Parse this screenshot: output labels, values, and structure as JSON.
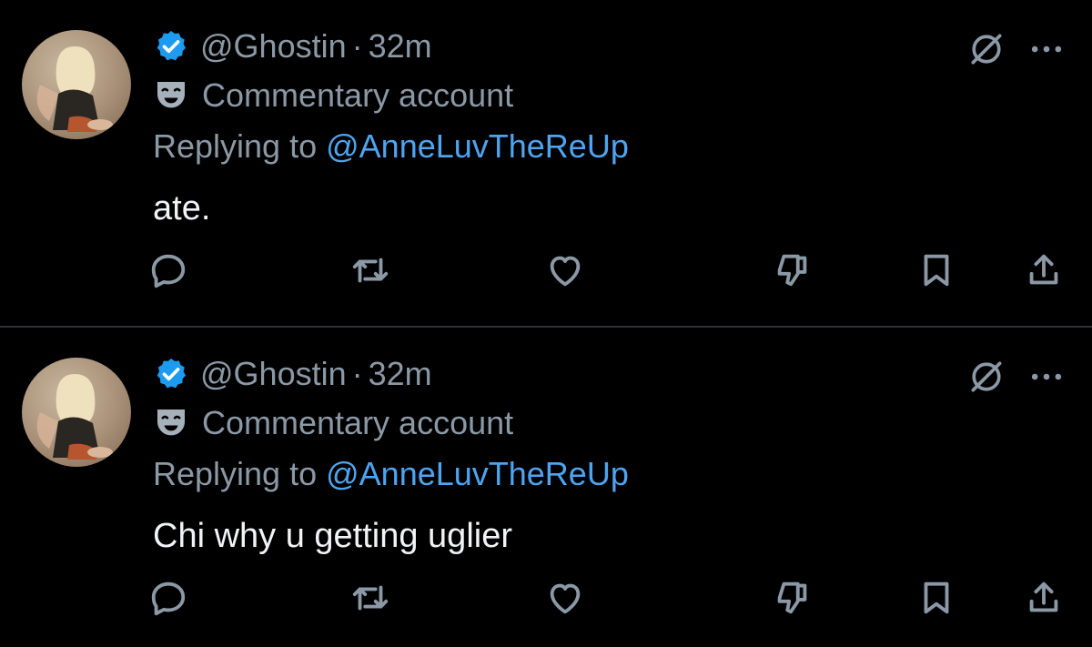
{
  "tweets": [
    {
      "handle": "@Ghostin",
      "separator": "·",
      "time": "32m",
      "account_label": "Commentary account",
      "replying_prefix": "Replying to",
      "replying_handle": "@AnneLuvTheReUp",
      "text": "ate."
    },
    {
      "handle": "@Ghostin",
      "separator": "·",
      "time": "32m",
      "account_label": "Commentary account",
      "replying_prefix": "Replying to",
      "replying_handle": "@AnneLuvTheReUp",
      "text": "Chi why u getting uglier"
    }
  ],
  "icons": {
    "verified": "verified-badge-icon",
    "label": "theater-mask-icon",
    "grok": "grok-icon",
    "more": "more-icon",
    "reply": "reply-icon",
    "retweet": "retweet-icon",
    "like": "like-icon",
    "dislike": "dislike-icon",
    "bookmark": "bookmark-icon",
    "share": "share-icon"
  },
  "colors": {
    "background": "#000000",
    "secondary_text": "#8b98a5",
    "link": "#4ea4ef",
    "verified": "#1d9bf0",
    "divider": "#2f3336"
  }
}
